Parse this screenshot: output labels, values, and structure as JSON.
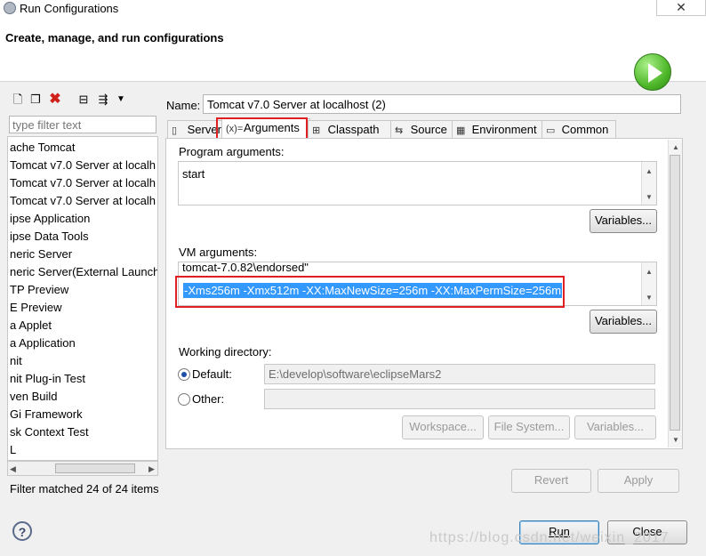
{
  "window": {
    "title": "Run Configurations",
    "close_symbol": "✕"
  },
  "header": {
    "title": "Create, manage, and run configurations"
  },
  "left": {
    "filter_placeholder": "type filter text",
    "tree": [
      "ache Tomcat",
      "Tomcat v7.0 Server at localh",
      "Tomcat v7.0 Server at localh",
      "Tomcat v7.0 Server at localh",
      "ipse Application",
      "ipse Data Tools",
      "neric Server",
      "neric Server(External Launch)",
      "TP Preview",
      "E Preview",
      "a Applet",
      "a Application",
      "nit",
      "nit Plug-in Test",
      "ven Build",
      "Gi Framework",
      "sk Context Test",
      "L"
    ],
    "status": "Filter matched 24 of 24 items"
  },
  "name": {
    "label": "Name:",
    "value": "Tomcat v7.0 Server at localhost (2)"
  },
  "tabs": [
    "Server",
    "Arguments",
    "Classpath",
    "Source",
    "Environment",
    "Common"
  ],
  "tab_icons": [
    "▯",
    "(x)=",
    "⊞",
    "⇆",
    "▦",
    "▭"
  ],
  "arguments": {
    "program_label": "Program arguments:",
    "program_value": "start",
    "variables_label": "Variables...",
    "vm_label": "VM arguments:",
    "vm_line1": "tomcat-7.0.82\\endorsed\"",
    "vm_line2": "-Xms256m -Xmx512m -XX:MaxNewSize=256m -XX:MaxPermSize=256m",
    "workdir_label": "Working directory:",
    "default_label": "Default:",
    "default_value": "E:\\develop\\software\\eclipseMars2",
    "other_label": "Other:",
    "workspace_btn": "Workspace...",
    "filesystem_btn": "File System...",
    "variables_btn": "Variables..."
  },
  "actions": {
    "revert": "Revert",
    "apply": "Apply",
    "run": "Run",
    "close": "Close"
  },
  "watermark": "https://blog.csdn.net/weixin_2017",
  "colors": {
    "selection": "#3399ff",
    "highlight": "#e02020",
    "run_green": "#4fb82a"
  }
}
